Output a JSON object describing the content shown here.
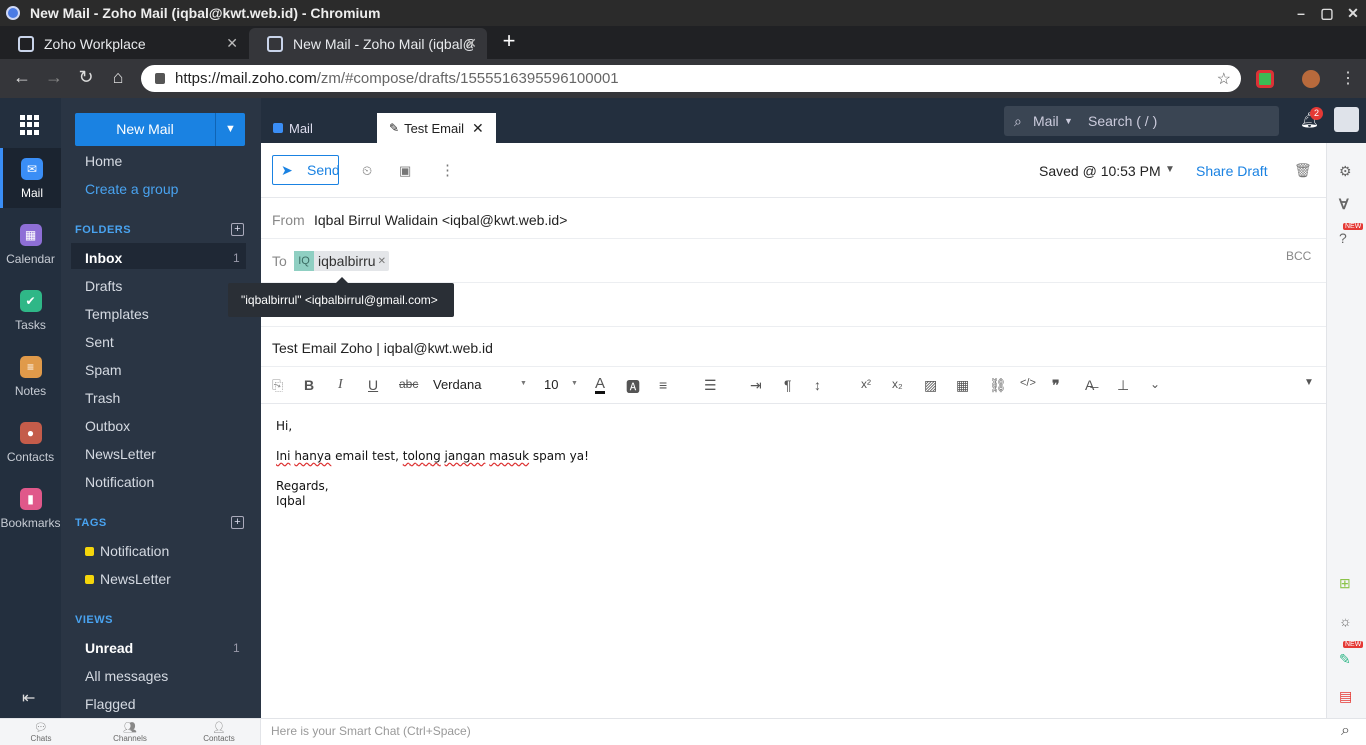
{
  "window": {
    "title": "New Mail - Zoho Mail (iqbal@kwt.web.id) - Chromium",
    "controls": [
      "–",
      "▢",
      "✕"
    ]
  },
  "browser": {
    "tabs": [
      {
        "label": "Zoho Workplace",
        "close": "✕"
      },
      {
        "label": "New Mail - Zoho Mail (iqbal@kw",
        "close": "✕"
      }
    ],
    "new_tab": "+",
    "url_host": "https://mail.zoho.com",
    "url_path": "/zm/#compose/drafts/1555516395596100001"
  },
  "launcher": {
    "apps": [
      {
        "label": "Mail",
        "color": "#3a8ef6",
        "glyph": "✉"
      },
      {
        "label": "Calendar",
        "color": "#8e6fd6",
        "glyph": "▦"
      },
      {
        "label": "Tasks",
        "color": "#2fb787",
        "glyph": "✔"
      },
      {
        "label": "Notes",
        "color": "#e09a4a",
        "glyph": "≡"
      },
      {
        "label": "Contacts",
        "color": "#c45c4a",
        "glyph": "●"
      },
      {
        "label": "Bookmarks",
        "color": "#e0588a",
        "glyph": "▮"
      }
    ]
  },
  "folders_panel": {
    "new_mail": "New Mail",
    "home": "Home",
    "create_group": "Create a group",
    "folders_header": "FOLDERS",
    "folders": [
      {
        "label": "Inbox",
        "count": "1"
      },
      {
        "label": "Drafts",
        "count": ""
      },
      {
        "label": "Templates",
        "count": ""
      },
      {
        "label": "Sent",
        "count": ""
      },
      {
        "label": "Spam",
        "count": ""
      },
      {
        "label": "Trash",
        "count": ""
      },
      {
        "label": "Outbox",
        "count": ""
      },
      {
        "label": "NewsLetter",
        "count": ""
      },
      {
        "label": "Notification",
        "count": ""
      }
    ],
    "tags_header": "TAGS",
    "tags": [
      "Notification",
      "NewsLetter"
    ],
    "views_header": "VIEWS",
    "views": [
      {
        "label": "Unread",
        "count": "1"
      },
      {
        "label": "All messages",
        "count": ""
      },
      {
        "label": "Flagged",
        "count": ""
      }
    ]
  },
  "topbar": {
    "tab_mail": "Mail",
    "tab_compose": "Test Email",
    "search_scope": "Mail",
    "search_placeholder": "Search ( / )",
    "notification_count": "2"
  },
  "compose": {
    "send": "Send",
    "saved": "Saved @ 10:53 PM",
    "share_draft": "Share Draft",
    "from_label": "From",
    "from_value": "Iqbal Birrul Walidain <iqbal@kwt.web.id>",
    "to_label": "To",
    "to_chip_initials": "IQ",
    "to_chip_name": "iqbalbirru",
    "bcc": "BCC",
    "tooltip": "\"iqbalbirrul\" <iqbalbirrul@gmail.com>",
    "subject": "Test Email Zoho | iqbal@kwt.web.id",
    "font": "Verdana",
    "size": "10",
    "body": {
      "greeting": "Hi,",
      "w1": "Ini",
      "w2": "hanya",
      "w3": " email test, ",
      "w4": "tolong",
      "w5": "jangan",
      "w6": "masuk",
      "w7": " spam ya!",
      "closing": "Regards,",
      "signature": "Iqbal"
    }
  },
  "rightrail": {
    "new_label": "NEW"
  },
  "bottombar": {
    "chats": "Chats",
    "channels": "Channels",
    "contacts": "Contacts",
    "smartchat_placeholder": "Here is your Smart Chat (Ctrl+Space)"
  }
}
